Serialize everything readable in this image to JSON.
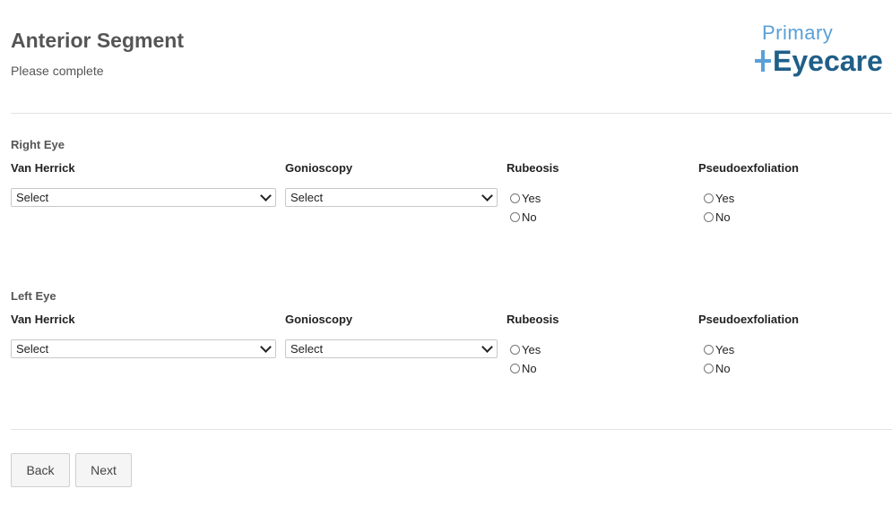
{
  "header": {
    "title": "Anterior Segment",
    "subtitle": "Please complete"
  },
  "logo": {
    "top": "Primary",
    "bottom": "Eyecare",
    "colors": {
      "accent": "#5aa0d8",
      "brand": "#1f5f88"
    }
  },
  "columns": {
    "van_herrick": "Van Herrick",
    "gonioscopy": "Gonioscopy",
    "rubeosis": "Rubeosis",
    "pseudoexfoliation": "Pseudoexfoliation"
  },
  "right_eye": {
    "label": "Right Eye",
    "van_herrick_value": "Select",
    "gonioscopy_value": "Select",
    "rubeosis": {
      "yes": "Yes",
      "no": "No"
    },
    "pseudoexfoliation": {
      "yes": "Yes",
      "no": "No"
    }
  },
  "left_eye": {
    "label": "Left Eye",
    "van_herrick_value": "Select",
    "gonioscopy_value": "Select",
    "rubeosis": {
      "yes": "Yes",
      "no": "No"
    },
    "pseudoexfoliation": {
      "yes": "Yes",
      "no": "No"
    }
  },
  "buttons": {
    "back": "Back",
    "next": "Next"
  }
}
